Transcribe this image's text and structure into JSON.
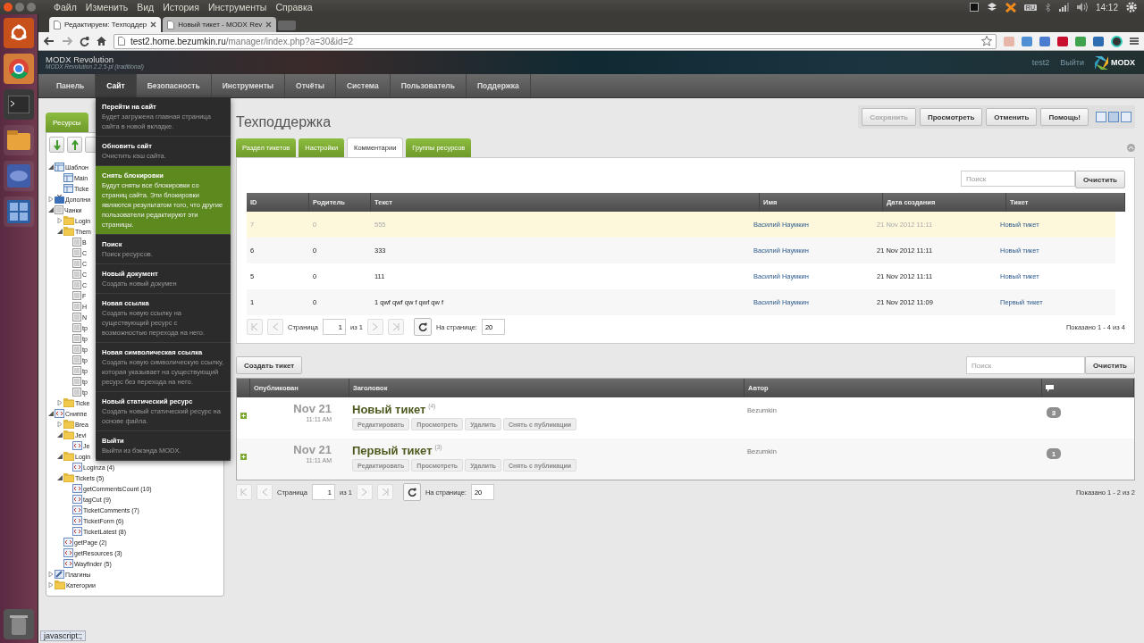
{
  "desktop_bar": {
    "menus": [
      "Файл",
      "Изменить",
      "Вид",
      "История",
      "Инструменты",
      "Справка"
    ],
    "keyboard": "RU",
    "clock": "14:12"
  },
  "browser": {
    "tabs": [
      {
        "title": "Редактируем: Техподдер",
        "selected": true
      },
      {
        "title": "Новый тикет - MODX Rev",
        "selected": false
      }
    ],
    "url_host": "test2.home.bezumkin.ru",
    "url_path": "/manager/index.php?a=30&id=2"
  },
  "header": {
    "brand": "MODX Revolution",
    "version": "MODX Revolution 2.2.5-pl (traditional)",
    "user": "test2",
    "logout": "Выйти",
    "logo": "MODX"
  },
  "nav": [
    {
      "label": "Панель",
      "selected": false
    },
    {
      "label": "Сайт",
      "selected": true
    },
    {
      "label": "Безопасность",
      "selected": false
    },
    {
      "label": "Инструменты",
      "selected": false
    },
    {
      "label": "Отчёты",
      "selected": false
    },
    {
      "label": "Система",
      "selected": false
    },
    {
      "label": "Пользователь",
      "selected": false
    },
    {
      "label": "Поддержка",
      "selected": false
    }
  ],
  "site_menu": [
    {
      "title": "Перейти на сайт",
      "description": "Будет загружена главная страница сайта в новой вкладке.",
      "highlighted": false
    },
    {
      "title": "Обновить сайт",
      "description": "Очистить кэш сайта.",
      "highlighted": false
    },
    {
      "title": "Снять блокировки",
      "description": "Будут сняты все блокировки со страниц сайта. Эти блокировки являются результатом того, что другие пользователи редактируют эти страницы.",
      "highlighted": true
    },
    {
      "title": "Поиск",
      "description": "Поиск ресурсов.",
      "highlighted": false
    },
    {
      "title": "Новый документ",
      "description": "Создать новый докумен",
      "highlighted": false
    },
    {
      "title": "Новая ссылка",
      "description": "Создать новую ссылку на существующий ресурс с возможностью перехода на него.",
      "highlighted": false
    },
    {
      "title": "Новая символическая ссылка",
      "description": "Создать новую символическую ссылку, которая указывает на существующий ресурс без перехода на него.",
      "highlighted": false
    },
    {
      "title": "Новый статический ресурс",
      "description": "Создать новый статический ресурс на основе файла.",
      "highlighted": false
    },
    {
      "title": "Выйти",
      "description": "Выйти из бэкэнда MODX.",
      "highlighted": false
    }
  ],
  "left_tabs": [
    {
      "label": "Ресурсы",
      "selected": true
    }
  ],
  "tree": [
    {
      "label": "Шаблон",
      "kind": "template",
      "expanded": true,
      "children": [
        {
          "label": "Main",
          "kind": "template"
        },
        {
          "label": "Ticke",
          "kind": "template"
        }
      ]
    },
    {
      "label": "Дополни",
      "kind": "tv",
      "expanded": false
    },
    {
      "label": "Чанки",
      "kind": "chunk",
      "expanded": true,
      "children": [
        {
          "label": "Login",
          "kind": "folder",
          "expanded": false
        },
        {
          "label": "Them",
          "kind": "folder",
          "expanded": true,
          "children": [
            {
              "label": "B",
              "kind": "chunk"
            },
            {
              "label": "C",
              "kind": "chunk"
            },
            {
              "label": "C",
              "kind": "chunk"
            },
            {
              "label": "C",
              "kind": "chunk"
            },
            {
              "label": "C",
              "kind": "chunk"
            },
            {
              "label": "F",
              "kind": "chunk"
            },
            {
              "label": "H",
              "kind": "chunk"
            },
            {
              "label": "N",
              "kind": "chunk"
            },
            {
              "label": "tp",
              "kind": "chunk"
            },
            {
              "label": "tp",
              "kind": "chunk"
            },
            {
              "label": "tp",
              "kind": "chunk"
            },
            {
              "label": "tp",
              "kind": "chunk"
            },
            {
              "label": "tp",
              "kind": "chunk"
            },
            {
              "label": "tp",
              "kind": "chunk"
            },
            {
              "label": "tp",
              "kind": "chunk"
            }
          ]
        },
        {
          "label": "Ticke",
          "kind": "folder",
          "expanded": false
        }
      ]
    },
    {
      "label": "Сниппе",
      "kind": "snippet",
      "expanded": true,
      "children": [
        {
          "label": "Brea",
          "kind": "folder",
          "expanded": false
        },
        {
          "label": "Jevi",
          "kind": "folder",
          "expanded": true,
          "children": [
            {
              "label": "Je",
              "kind": "snippet"
            }
          ]
        },
        {
          "label": "Login",
          "kind": "folder",
          "expanded": true,
          "children": [
            {
              "label": "Loginza (4)",
              "kind": "snippet"
            }
          ]
        },
        {
          "label": "Tickets (5)",
          "kind": "folder",
          "expanded": true,
          "children": [
            {
              "label": "getCommentsCount (10)",
              "kind": "snippet"
            },
            {
              "label": "tagCut (9)",
              "kind": "snippet"
            },
            {
              "label": "TicketComments (7)",
              "kind": "snippet"
            },
            {
              "label": "TicketForm (6)",
              "kind": "snippet"
            },
            {
              "label": "TicketLatest (8)",
              "kind": "snippet"
            }
          ]
        },
        {
          "label": "getPage (2)",
          "kind": "snippet"
        },
        {
          "label": "getResources (3)",
          "kind": "snippet"
        },
        {
          "label": "Wayfinder (5)",
          "kind": "snippet"
        }
      ]
    },
    {
      "label": "Плагины",
      "kind": "plugin",
      "expanded": false
    },
    {
      "label": "Категории",
      "kind": "folder",
      "expanded": false
    }
  ],
  "page": {
    "title": "Техподдержка",
    "actions": [
      {
        "label": "Сохранить",
        "disabled": true
      },
      {
        "label": "Просмотреть",
        "disabled": false
      },
      {
        "label": "Отменить",
        "disabled": false
      },
      {
        "label": "Помощь!",
        "disabled": false
      }
    ],
    "tabs": [
      {
        "label": "Раздел тикетов",
        "selected": false
      },
      {
        "label": "Настройки",
        "selected": false
      },
      {
        "label": "Комментарии",
        "selected": true
      },
      {
        "label": "Группы ресурсов",
        "selected": false
      }
    ]
  },
  "comments": {
    "search_placeholder": "Поиск",
    "clear": "Очистить",
    "columns": [
      "ID",
      "Родитель",
      "Текст",
      "Имя",
      "Дата создания",
      "Тикет"
    ],
    "rows": [
      {
        "id": "7",
        "parent": "0",
        "text": "555",
        "name": "Василий Наумкин",
        "date": "21 Nov 2012 11:11",
        "ticket": "Новый тикет",
        "selected": true,
        "disabled": true
      },
      {
        "id": "6",
        "parent": "0",
        "text": "333",
        "name": "Василий Наумкин",
        "date": "21 Nov 2012 11:11",
        "ticket": "Новый тикет",
        "selected": false,
        "disabled": false
      },
      {
        "id": "5",
        "parent": "0",
        "text": "111",
        "name": "Василий Наумкин",
        "date": "21 Nov 2012 11:11",
        "ticket": "Новый тикет",
        "selected": false,
        "disabled": false
      },
      {
        "id": "1",
        "parent": "0",
        "text": "1 qwf qwf qw f qwf qw f",
        "name": "Василий Наумкин",
        "date": "21 Nov 2012 11:09",
        "ticket": "Первый тикет",
        "selected": false,
        "disabled": false
      }
    ],
    "pager": {
      "page_label": "Страница",
      "page": "1",
      "of": "из 1",
      "per_page_label": "На странице:",
      "per_page": "20",
      "summary": "Показано 1 - 4 из 4"
    }
  },
  "tickets": {
    "create": "Создать тикет",
    "search_placeholder": "Поиск",
    "clear": "Очистить",
    "columns": [
      "Опубликован",
      "Заголовок",
      "Автор"
    ],
    "rows": [
      {
        "date": "Nov 21",
        "time": "11:11 AM",
        "title": "Новый тикет",
        "count": "(4)",
        "actions": [
          "Редактировать",
          "Просмотреть",
          "Удалить",
          "Снять с публикации"
        ],
        "author": "Bezumkin",
        "comments": "3"
      },
      {
        "date": "Nov 21",
        "time": "11:11 AM",
        "title": "Первый тикет",
        "count": "(3)",
        "actions": [
          "Редактировать",
          "Просмотреть",
          "Удалить",
          "Снять с публикации"
        ],
        "author": "Bezumkin",
        "comments": "1"
      }
    ],
    "pager": {
      "page_label": "Страница",
      "page": "1",
      "of": "из 1",
      "per_page_label": "На странице:",
      "per_page": "20",
      "summary": "Показано 1 - 2 из 2"
    }
  },
  "status_bar": "javascript:;"
}
